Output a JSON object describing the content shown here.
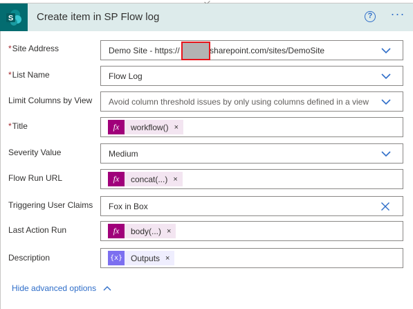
{
  "header": {
    "title": "Create item in SP Flow log",
    "app_tile_letter": "S",
    "brand_color": "#036c70",
    "help_glyph": "?",
    "more_glyph": "···"
  },
  "fields": {
    "site_address": {
      "label": "Site Address",
      "required": "*",
      "value_prefix": "Demo Site - https://",
      "value_suffix": ".sharepoint.com/sites/DemoSite"
    },
    "list_name": {
      "label": "List Name",
      "required": "*",
      "value": "Flow Log"
    },
    "limit_columns": {
      "label": "Limit Columns by View",
      "placeholder": "Avoid column threshold issues by only using columns defined in a view"
    },
    "title": {
      "label": "Title",
      "required": "*",
      "token": "workflow()",
      "token_icon": "fx"
    },
    "severity": {
      "label": "Severity Value",
      "value": "Medium"
    },
    "flow_run_url": {
      "label": "Flow Run URL",
      "token": "concat(...)",
      "token_icon": "fx"
    },
    "triggering_user_claims": {
      "label": "Triggering User Claims",
      "value": "Fox in Box"
    },
    "last_action_run": {
      "label": "Last Action Run",
      "token": "body(...)",
      "token_icon": "fx"
    },
    "description": {
      "label": "Description",
      "token": "Outputs",
      "token_icon": "{x}"
    }
  },
  "token_remove_glyph": "×",
  "footer": {
    "hide_advanced_label": "Hide advanced options"
  },
  "colors": {
    "accent": "#2f6ec9",
    "expression_token": "#a0007a",
    "variable_token": "#7c6ff0",
    "required": "#a4262c"
  }
}
